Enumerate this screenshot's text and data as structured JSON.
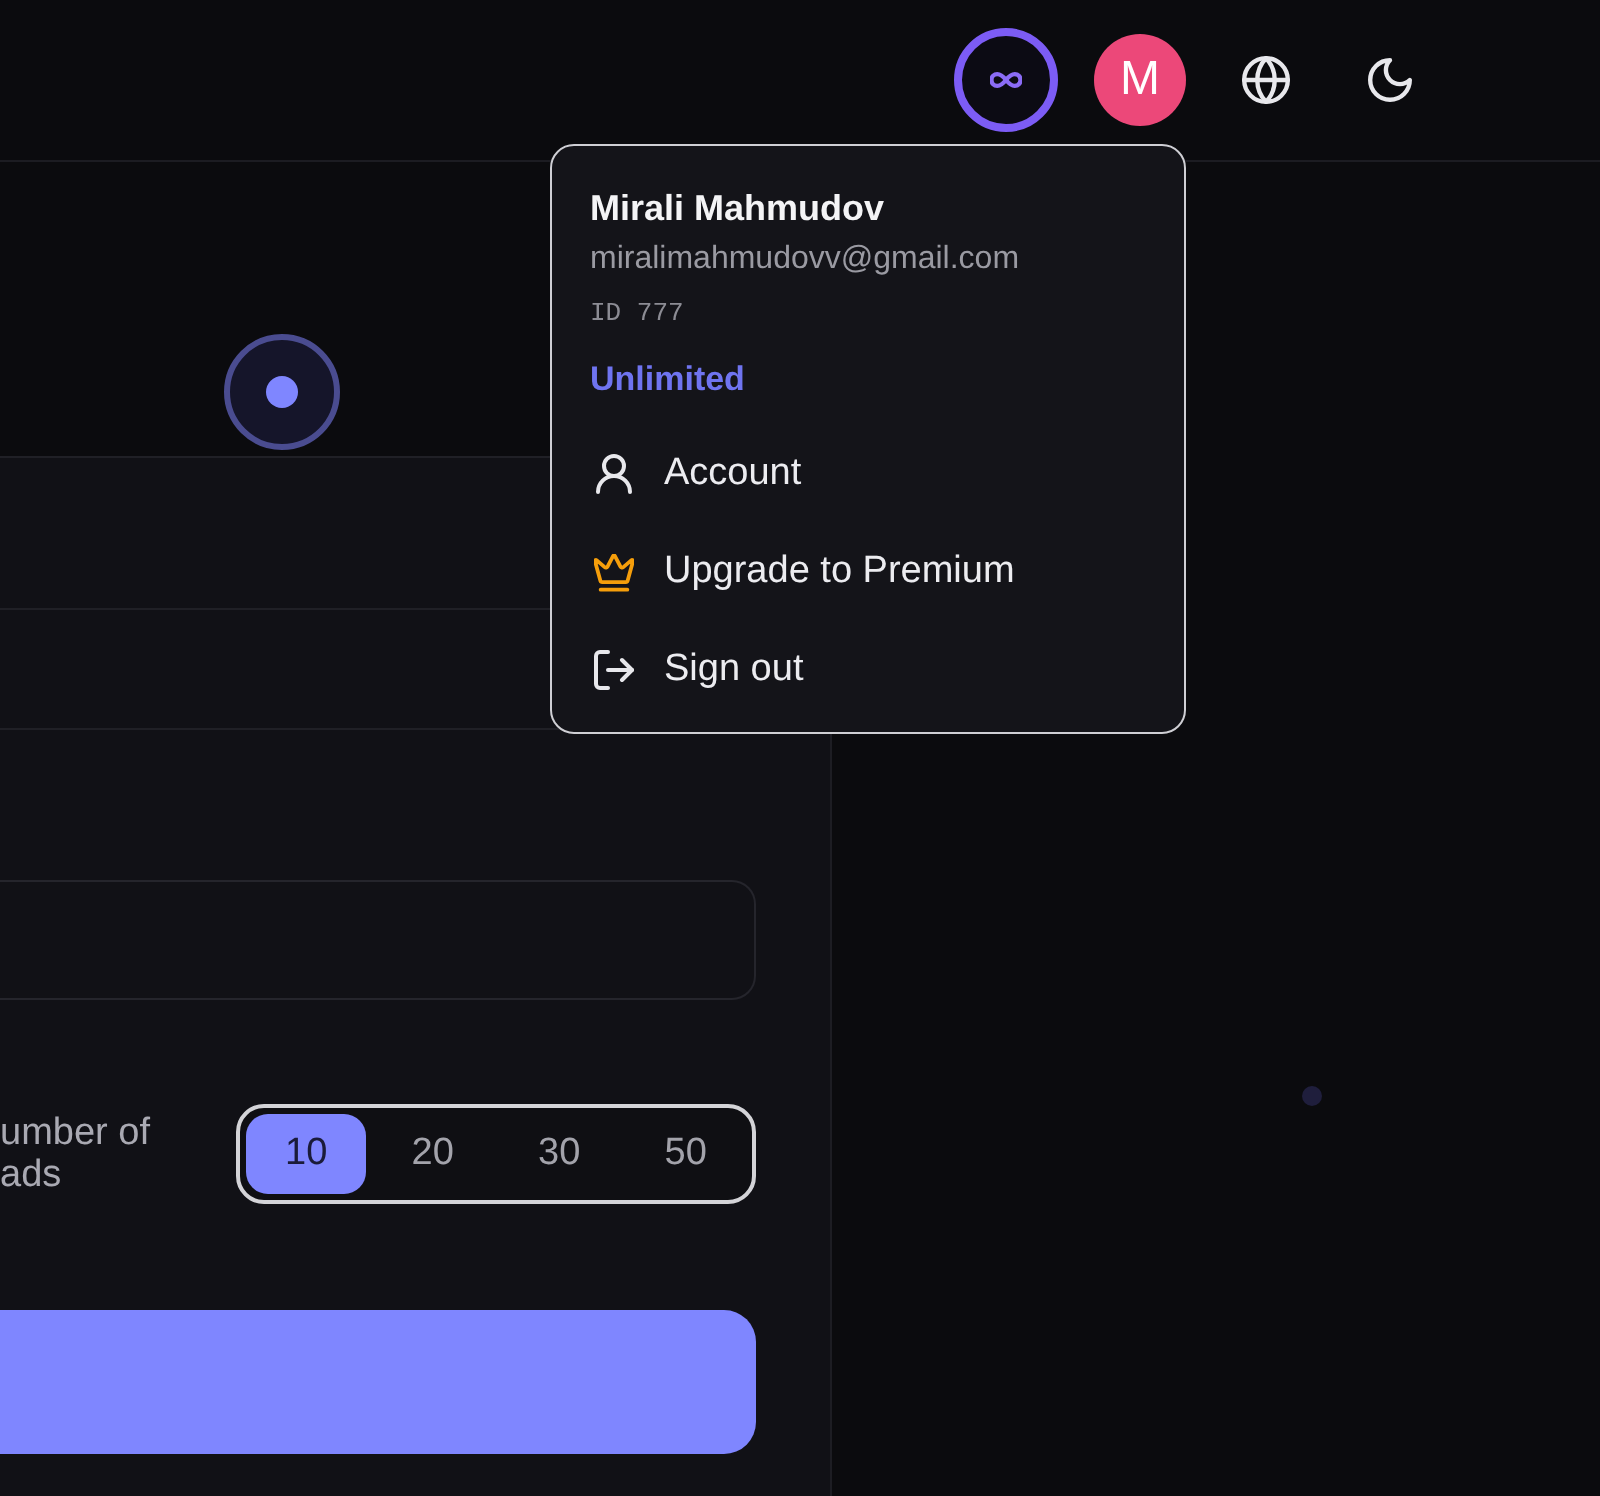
{
  "header": {
    "avatar_initial": "M"
  },
  "form": {
    "count_label": "umber of ads",
    "count_options": [
      {
        "label": "10",
        "selected": true
      },
      {
        "label": "20",
        "selected": false
      },
      {
        "label": "30",
        "selected": false
      },
      {
        "label": "50",
        "selected": false
      }
    ]
  },
  "account_menu": {
    "name": "Mirali Mahmudov",
    "email": "miralimahmudovv@gmail.com",
    "user_id": "ID 777",
    "plan": "Unlimited",
    "items": [
      {
        "kind": "account",
        "label": "Account"
      },
      {
        "kind": "premium",
        "label": "Upgrade to Premium"
      },
      {
        "kind": "sign-out",
        "label": "Sign out"
      }
    ]
  }
}
